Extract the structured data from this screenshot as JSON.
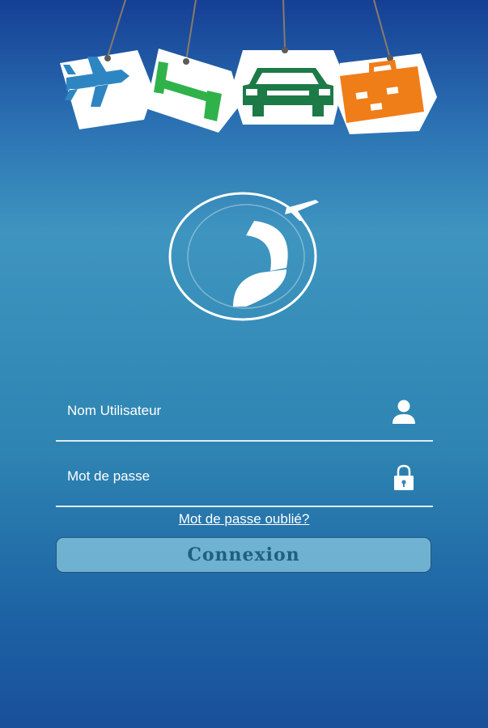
{
  "banner": {
    "tags": [
      {
        "name": "airplane-tag",
        "color": "#2d86c2"
      },
      {
        "name": "bed-tag",
        "color": "#2fb24a"
      },
      {
        "name": "car-tag",
        "color": "#1c7a47"
      },
      {
        "name": "suitcase-tag",
        "color": "#ef7d18"
      }
    ]
  },
  "login": {
    "username_placeholder": "Nom Utilisateur",
    "password_placeholder": "Mot de passe",
    "forgot_label": "Mot de passe oublié?",
    "submit_label": "Connexion"
  },
  "icons": {
    "username": "user-icon",
    "password": "lock-icon",
    "logo": "globe-plane-logo"
  }
}
